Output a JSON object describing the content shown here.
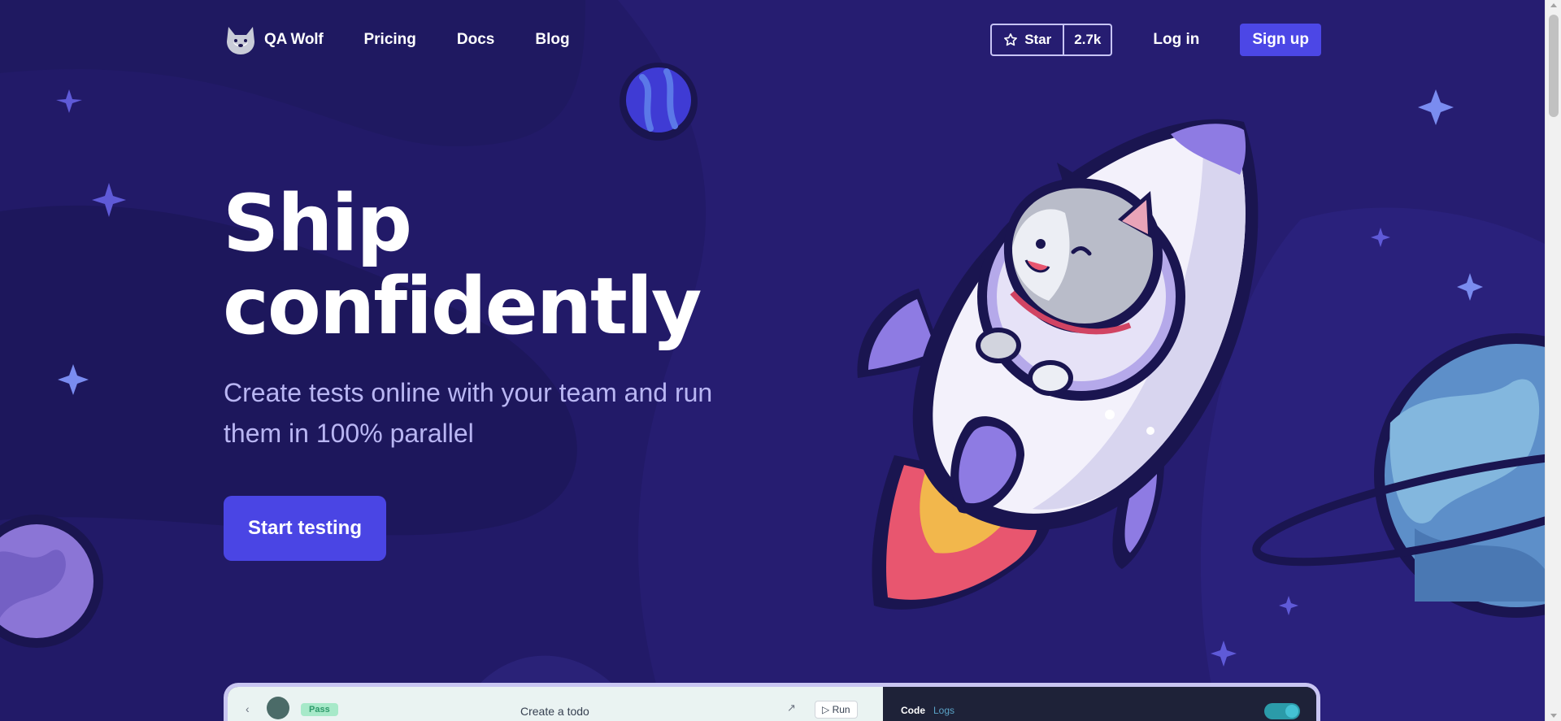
{
  "nav": {
    "brand": "QA Wolf",
    "links": [
      "Pricing",
      "Docs",
      "Blog"
    ],
    "github_star_label": "Star",
    "github_star_count": "2.7k",
    "login": "Log in",
    "signup": "Sign up"
  },
  "hero": {
    "title_line1": "Ship",
    "title_line2": "confidently",
    "subtitle": "Create tests online with your team and run them in 100% parallel",
    "cta": "Start testing"
  },
  "preview": {
    "status": "Pass",
    "test_name": "Create a todo",
    "run_label": "Run",
    "tab_code": "Code",
    "tab_logs": "Logs"
  },
  "colors": {
    "background": "#221a68",
    "accent": "#4c47e6",
    "subtitle": "#b9b6f3"
  },
  "icons": [
    "wolf-logo-icon",
    "star-icon",
    "back-icon",
    "external-link-icon",
    "play-icon",
    "rocket-illustration"
  ]
}
